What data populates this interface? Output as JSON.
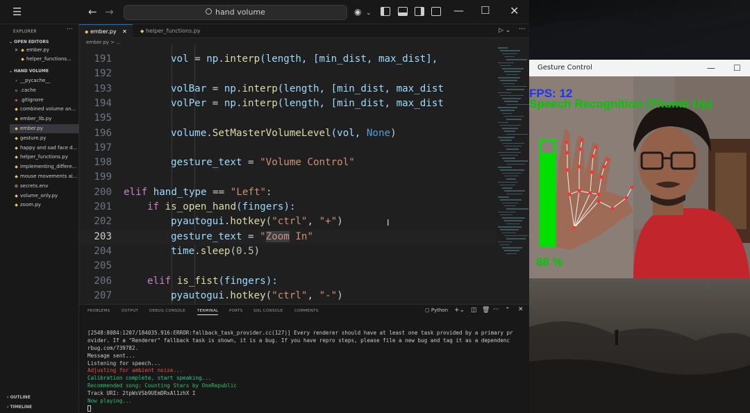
{
  "vscode": {
    "search_text": "hand volume",
    "sidebar": {
      "explorer_label": "EXPLORER",
      "open_editors_label": "OPEN EDITORS",
      "open_editors": [
        {
          "close": "✕",
          "name": "ember.py"
        },
        {
          "close": "",
          "name": "helper_functions..."
        }
      ],
      "folder_label": "HAND VOLUME",
      "files": [
        {
          "name": "__pycache__",
          "icon": "folder-icon"
        },
        {
          "name": ".cache",
          "icon": "file-icon"
        },
        {
          "name": ".gitignore",
          "icon": "git-icon"
        },
        {
          "name": "combined volume an...",
          "icon": "python-icon"
        },
        {
          "name": "ember_lib.py",
          "icon": "python-icon"
        },
        {
          "name": "ember.py",
          "icon": "python-icon"
        },
        {
          "name": "gesture.py",
          "icon": "python-icon"
        },
        {
          "name": "happy and sad face d...",
          "icon": "python-icon"
        },
        {
          "name": "helper_functions.py",
          "icon": "python-icon"
        },
        {
          "name": "implementing_differe...",
          "icon": "python-icon"
        },
        {
          "name": "mouse movements ai...",
          "icon": "python-icon"
        },
        {
          "name": "secrets.env",
          "icon": "env-icon"
        },
        {
          "name": "volume_only.py",
          "icon": "python-icon"
        },
        {
          "name": "zoom.py",
          "icon": "python-icon"
        }
      ],
      "outline_label": "OUTLINE",
      "timeline_label": "TIMELINE"
    },
    "tabs": [
      {
        "label": "ember.py",
        "close": "✕"
      },
      {
        "label": "helper_functions.py",
        "close": ""
      }
    ],
    "breadcrumb": "ember.py > ...",
    "code_lines": [
      {
        "n": "191",
        "indent": 2,
        "tokens": [
          [
            "vol",
            "var"
          ],
          [
            " = ",
            "plain"
          ],
          [
            "np",
            "var"
          ],
          [
            ".",
            "plain"
          ],
          [
            "interp",
            "fn"
          ],
          [
            "(length, [min_dist, max_dist],",
            "var"
          ]
        ]
      },
      {
        "n": "192",
        "indent": 0,
        "tokens": []
      },
      {
        "n": "193",
        "indent": 2,
        "tokens": [
          [
            "volBar",
            "var"
          ],
          [
            " = ",
            "plain"
          ],
          [
            "np",
            "var"
          ],
          [
            ".",
            "plain"
          ],
          [
            "interp",
            "fn"
          ],
          [
            "(length, [min_dist, max_dist",
            "var"
          ]
        ]
      },
      {
        "n": "194",
        "indent": 2,
        "tokens": [
          [
            "volPer",
            "var"
          ],
          [
            " = ",
            "plain"
          ],
          [
            "np",
            "var"
          ],
          [
            ".",
            "plain"
          ],
          [
            "interp",
            "fn"
          ],
          [
            "(length, [min_dist, max_dist",
            "var"
          ]
        ]
      },
      {
        "n": "195",
        "indent": 0,
        "tokens": []
      },
      {
        "n": "196",
        "indent": 2,
        "tokens": [
          [
            "volume",
            "var"
          ],
          [
            ".",
            "plain"
          ],
          [
            "SetMasterVolumeLevel",
            "fn"
          ],
          [
            "(vol, ",
            "var"
          ],
          [
            "None",
            "const"
          ],
          [
            ")",
            "plain"
          ]
        ]
      },
      {
        "n": "197",
        "indent": 0,
        "tokens": []
      },
      {
        "n": "198",
        "indent": 2,
        "tokens": [
          [
            "gesture_text",
            "var"
          ],
          [
            " = ",
            "plain"
          ],
          [
            "\"Volume Control\"",
            "str"
          ]
        ]
      },
      {
        "n": "199",
        "indent": 0,
        "tokens": []
      },
      {
        "n": "200",
        "indent": 0,
        "tokens": [
          [
            "elif",
            "kw"
          ],
          [
            " hand_type ",
            "var"
          ],
          [
            "==",
            "plain"
          ],
          [
            " \"Left\"",
            "str"
          ],
          [
            ":",
            "plain"
          ]
        ]
      },
      {
        "n": "201",
        "indent": 1,
        "tokens": [
          [
            "if",
            "kw"
          ],
          [
            " ",
            "plain"
          ],
          [
            "is_open_hand",
            "fn"
          ],
          [
            "(fingers):",
            "var"
          ]
        ]
      },
      {
        "n": "202",
        "indent": 2,
        "tokens": [
          [
            "pyautogui",
            "var"
          ],
          [
            ".",
            "plain"
          ],
          [
            "hotkey",
            "fn"
          ],
          [
            "(",
            "plain"
          ],
          [
            "\"ctrl\"",
            "str"
          ],
          [
            ", ",
            "plain"
          ],
          [
            "\"+\"",
            "str"
          ],
          [
            ")",
            "plain"
          ]
        ]
      },
      {
        "n": "203",
        "indent": 2,
        "tokens": [
          [
            "gesture_text",
            "var"
          ],
          [
            " = ",
            "plain"
          ],
          [
            "\"",
            "str"
          ],
          [
            "Zoom",
            "strsel"
          ],
          [
            " In\"",
            "str"
          ]
        ]
      },
      {
        "n": "204",
        "indent": 2,
        "tokens": [
          [
            "time",
            "var"
          ],
          [
            ".",
            "plain"
          ],
          [
            "sleep",
            "fn"
          ],
          [
            "(",
            "plain"
          ],
          [
            "0.5",
            "num"
          ],
          [
            ")",
            "plain"
          ]
        ]
      },
      {
        "n": "205",
        "indent": 0,
        "tokens": []
      },
      {
        "n": "206",
        "indent": 1,
        "tokens": [
          [
            "elif",
            "kw"
          ],
          [
            " ",
            "plain"
          ],
          [
            "is_fist",
            "fn"
          ],
          [
            "(fingers):",
            "var"
          ]
        ]
      },
      {
        "n": "207",
        "indent": 2,
        "tokens": [
          [
            "pyautogui",
            "var"
          ],
          [
            ".",
            "plain"
          ],
          [
            "hotkey",
            "fn"
          ],
          [
            "(",
            "plain"
          ],
          [
            "\"ctrl\"",
            "str"
          ],
          [
            ", ",
            "plain"
          ],
          [
            "\"-\"",
            "str"
          ],
          [
            ")",
            "plain"
          ]
        ]
      }
    ],
    "current_line": "203",
    "panel_tabs": [
      "PROBLEMS",
      "OUTPUT",
      "DEBUG CONSOLE",
      "TERMINAL",
      "PORTS",
      "SQL CONSOLE",
      "COMMENTS"
    ],
    "active_panel_tab": "TERMINAL",
    "terminal_shell": "Python",
    "terminal_lines": [
      {
        "text": "[2548:8084:1207/184035.916:ERROR:fallback_task_provider.cc(127)] Every renderer should have at least one task provided by a primary pr",
        "color": "w"
      },
      {
        "text": "ovider. If a \"Renderer\" fallback task is shown, it is a bug. If you have repro steps, please file a new bug and tag it as a dependenc",
        "color": "w"
      },
      {
        "text": "rbug.com/739782.",
        "color": "w"
      },
      {
        "text": "Message sent...",
        "color": "w"
      },
      {
        "text": "Listening for speech...",
        "color": "w"
      },
      {
        "text": "Adjusting for ambient noise...",
        "color": "r"
      },
      {
        "text": "Calibration complete, start speaking...",
        "color": "g"
      },
      {
        "text": "Recommended song: Counting Stars by OneRepublic",
        "color": "gg"
      },
      {
        "text": "Track URI: 2tpWsVSb9UEmDRxAl1zhX I",
        "color": "w"
      },
      {
        "text": "Now playing...",
        "color": "gg"
      }
    ]
  },
  "gesture_window": {
    "title": "Gesture Control",
    "fps_text": "FPS: 12",
    "mode_text": "Speech Recognition (Thumb Up)",
    "volume_percent_text": "88 %",
    "volume_level": 0.88,
    "min_symbol": "—",
    "max_symbol": "☐",
    "colors": {
      "fps": "#1a35ff",
      "mode": "#00c800",
      "bar": "#00e000"
    }
  }
}
